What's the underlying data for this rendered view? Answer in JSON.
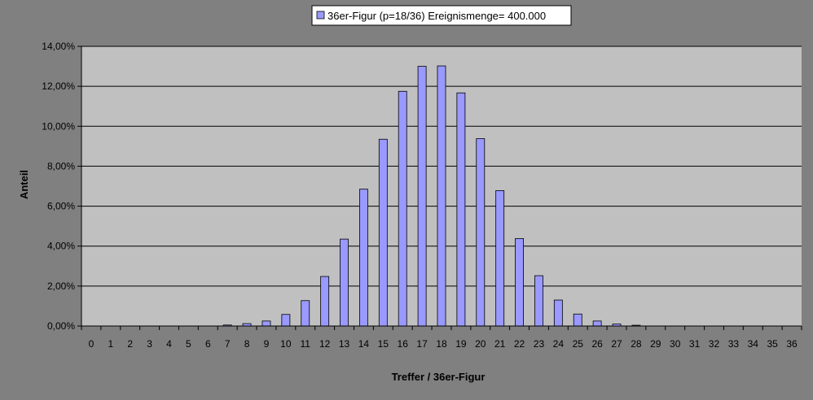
{
  "chart_data": {
    "type": "bar",
    "legend": {
      "placement": "top-center"
    },
    "grid": true,
    "xlabel": "Treffer / 36er-Figur",
    "ylabel": "Anteil",
    "ylim": [
      0,
      0.14
    ],
    "y_ticks": [
      0,
      0.02,
      0.04,
      0.06,
      0.08,
      0.1,
      0.12,
      0.14
    ],
    "y_tick_labels": [
      "0,00%",
      "2,00%",
      "4,00%",
      "6,00%",
      "8,00%",
      "10,00%",
      "12,00%",
      "14,00%"
    ],
    "categories": [
      "0",
      "1",
      "2",
      "3",
      "4",
      "5",
      "6",
      "7",
      "8",
      "9",
      "10",
      "11",
      "12",
      "13",
      "14",
      "15",
      "16",
      "17",
      "18",
      "19",
      "20",
      "21",
      "22",
      "23",
      "24",
      "25",
      "26",
      "27",
      "28",
      "29",
      "30",
      "31",
      "32",
      "33",
      "34",
      "35",
      "36"
    ],
    "series": [
      {
        "name": "36er-Figur (p=18/36) Ereignismenge= 400.000",
        "color": "#9999ff",
        "values": [
          0,
          0,
          0,
          0,
          0,
          0,
          0,
          0.0005,
          0.0012,
          0.0025,
          0.0058,
          0.0127,
          0.0248,
          0.0435,
          0.0685,
          0.0935,
          0.1175,
          0.13,
          0.1302,
          0.1167,
          0.0938,
          0.0678,
          0.0438,
          0.0252,
          0.013,
          0.006,
          0.0025,
          0.001,
          0.0004,
          0,
          0,
          0,
          0,
          0,
          0,
          0,
          0
        ]
      }
    ]
  },
  "colors": {
    "outer_background": "#808080",
    "plot_background": "#c0c0c0",
    "bar_fill": "#9999ff",
    "bar_stroke": "#000000",
    "gridline": "#000000"
  }
}
